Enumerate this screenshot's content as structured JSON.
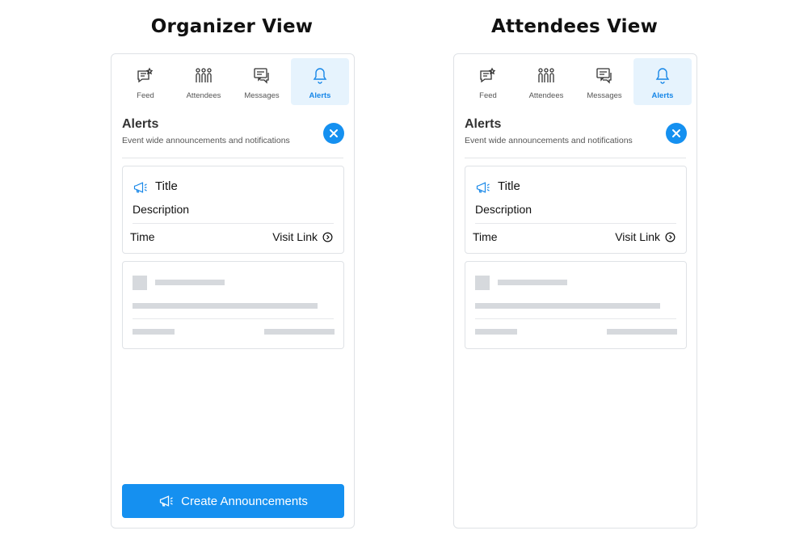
{
  "views": {
    "organizer": {
      "heading": "Organizer View"
    },
    "attendees": {
      "heading": "Attendees View"
    }
  },
  "tabs": [
    {
      "label": "Feed",
      "icon": "feed-icon"
    },
    {
      "label": "Attendees",
      "icon": "attendees-icon"
    },
    {
      "label": "Messages",
      "icon": "messages-icon"
    },
    {
      "label": "Alerts",
      "icon": "bell-icon",
      "active": true
    }
  ],
  "alerts": {
    "title": "Alerts",
    "subtitle": "Event wide announcements and notifications",
    "close_icon": "close-icon"
  },
  "alert_card": {
    "icon": "megaphone-icon",
    "title": "Title",
    "description": "Description",
    "time": "Time",
    "link_label": "Visit Link",
    "link_icon": "chevron-right-circle-icon"
  },
  "create_button": {
    "label": "Create Announcements",
    "icon": "megaphone-icon"
  },
  "colors": {
    "accent": "#1590f0",
    "active_tab_bg": "#e6f3fd",
    "skeleton": "#d6d9dd",
    "border": "#dfe2e6"
  }
}
